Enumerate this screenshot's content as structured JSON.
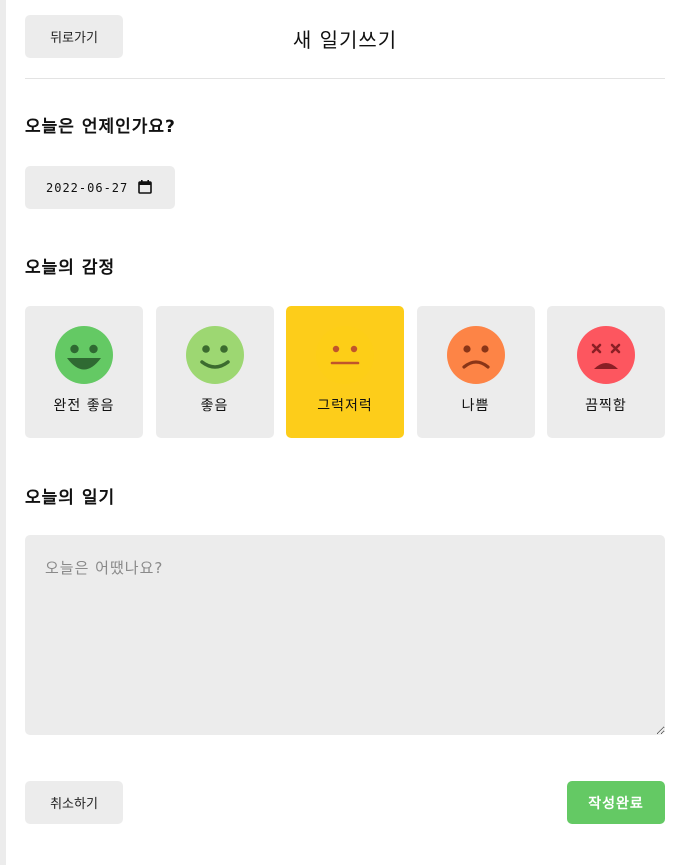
{
  "header": {
    "back_label": "뒤로가기",
    "title": "새 일기쓰기"
  },
  "date_section": {
    "title": "오늘은 언제인가요?",
    "value": "2022-06-27",
    "icon": "calendar-icon"
  },
  "emotion_section": {
    "title": "오늘의 감정",
    "selected_index": 2,
    "items": [
      {
        "label": "완전 좋음",
        "color": "#64c964"
      },
      {
        "label": "좋음",
        "color": "#9dd772"
      },
      {
        "label": "그럭저럭",
        "color": "#fdce17"
      },
      {
        "label": "나쁨",
        "color": "#fd8446"
      },
      {
        "label": "끔찍함",
        "color": "#fd565f"
      }
    ]
  },
  "diary_section": {
    "title": "오늘의 일기",
    "placeholder": "오늘은 어땠나요?",
    "value": ""
  },
  "footer": {
    "cancel_label": "취소하기",
    "submit_label": "작성완료"
  },
  "colors": {
    "accent": "#64c964",
    "panel": "#ececec",
    "selected": "#fdcd1a"
  }
}
